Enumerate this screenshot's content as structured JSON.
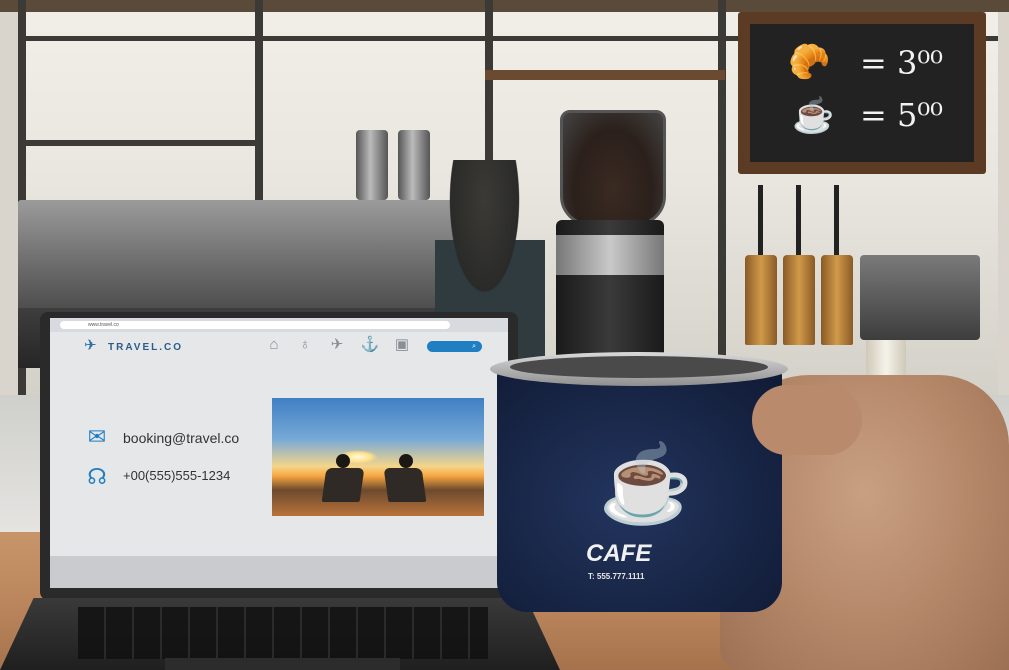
{
  "chalkboard": {
    "item1_icon": "croissant-icon",
    "item1_price": "= 3⁰⁰",
    "item2_icon": "coffee-cup-icon",
    "item2_price": "= 5⁰⁰"
  },
  "laptop_site": {
    "url": "www.travel.co",
    "brand": "TRAVEL.CO",
    "nav_icons": [
      "home-icon",
      "location-pin-icon",
      "plane-icon",
      "anchor-icon",
      "bus-icon"
    ],
    "email": "booking@travel.co",
    "phone": "+00(555)555-1234",
    "photo_description_icon": "beach-sunset-photo"
  },
  "mug": {
    "brand": "CAFE",
    "phone": "T: 555.777.1111"
  },
  "colors": {
    "accent_blue": "#1f7fc2",
    "mug_blue": "#1a2a52",
    "wood": "#c08a60"
  }
}
